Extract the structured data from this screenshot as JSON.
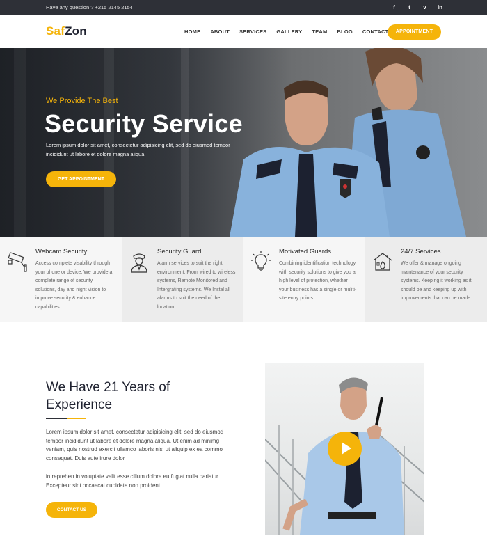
{
  "topbar": {
    "contact": "Have any question ? +215 2145 2154",
    "socials": [
      "f",
      "t",
      "v",
      "in"
    ]
  },
  "header": {
    "logo_a": "Saf",
    "logo_b": "Zon",
    "nav": [
      "HOME",
      "ABOUT",
      "SERVICES",
      "GALLERY",
      "TEAM",
      "BLOG",
      "CONTACT"
    ],
    "appointment_label": "APPOINTMENT"
  },
  "hero": {
    "tagline": "We Provide The Best",
    "title": "Security Service",
    "description": "Lorem ipsum dolor sit amet, consectetur adipisicing elit, sed do eiusmod tempor incididunt ut labore et dolore magna aliqua.",
    "cta_label": "GET APPOINTMENT"
  },
  "features": [
    {
      "title": "Webcam Security",
      "icon": "cctv-camera-icon",
      "text": "Access complete visability through your phone or device. We provide a complete range of security solutions, day and night vision to improve security & enhance capabilities."
    },
    {
      "title": "Security Guard",
      "icon": "guard-icon",
      "text": "Alarm services to suit the right environment. From wired to wireless systems, Remote Monitored and Intergrating systems. We Instal all alarms to suit the need of the location."
    },
    {
      "title": "Motivated Guards",
      "icon": "lightbulb-icon",
      "text": "Combining identification technology with security solutions to give you a high level of protection, whether your business has a single or muliti-site entry points."
    },
    {
      "title": "24/7 Services",
      "icon": "house-fire-icon",
      "text": "We offer & manage ongoing maintenance of your security systems. Keeping it working as it should be and keeping up with improvements that can be made."
    }
  ],
  "about": {
    "title": "We Have 21 Years of Experience",
    "paragraph1": "Lorem ipsum dolor sit amet, consectetur adipisicing elit, sed do eiusmod tempor incididunt ut labore et dolore magna aliqua. Ut enim ad minimg veniam, quis nostrud exercit ullamco laboris nisi ut aliquip ex ea commo consequat. Duis aute irure dolor",
    "paragraph2": "in reprehen in voluptate velit esse cillum dolore eu fugiat nulla pariatur Excepteur sint occaecat cupidata non proident.",
    "contact_label": "CONTACT US"
  },
  "colors": {
    "accent": "#f5b40a",
    "topbar": "#2e3037",
    "dark_text": "#1f2230"
  }
}
